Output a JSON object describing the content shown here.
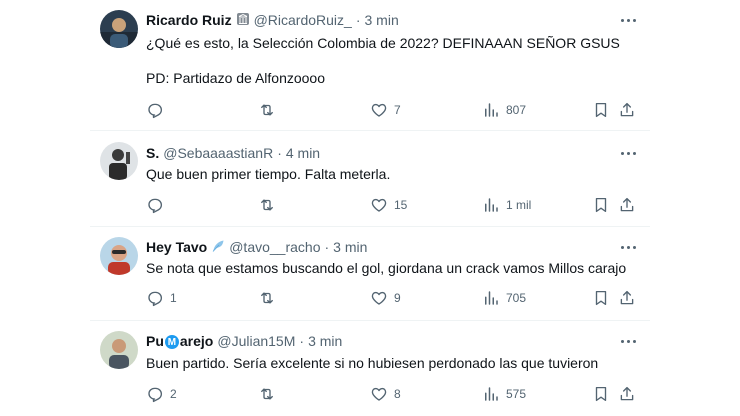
{
  "tweets": [
    {
      "name": "Ricardo Ruiz",
      "handle": "@RicardoRuiz_",
      "separator": "·",
      "time": "3 min",
      "text1": "¿Qué es esto, la Selección Colombia de 2022? DEFINAAAN SEÑOR GSUS",
      "text2": "PD: Partidazo de Alfonzoooo",
      "replies": "",
      "retweets": "",
      "likes": "7",
      "views": "807"
    },
    {
      "name": "S.",
      "handle": "@SebaaaastianR",
      "separator": "·",
      "time": "4 min",
      "text1": "Que buen primer tiempo. Falta meterla.",
      "replies": "",
      "retweets": "",
      "likes": "15",
      "views": "1 mil"
    },
    {
      "name": "Hey Tavo",
      "handle": "@tavo__racho",
      "separator": "·",
      "time": "3 min",
      "text1": "Se nota que estamos buscando el gol, giordana un crack vamos Millos carajo",
      "replies": "1",
      "retweets": "",
      "likes": "9",
      "views": "705"
    },
    {
      "name_a": "Pu",
      "name_m": "M",
      "name_b": "arejo",
      "handle": "@Julian15M",
      "separator": "·",
      "time": "3 min",
      "text1": "Buen partido. Sería excelente si no hubiesen perdonado las que tuvieron",
      "replies": "2",
      "retweets": "",
      "likes": "8",
      "views": "575"
    }
  ],
  "colors": {
    "text": "#0f1419",
    "muted": "#536471",
    "divider": "#eff3f4",
    "accent": "#1d9bf0"
  },
  "icons": [
    "reply-icon",
    "retweet-icon",
    "like-icon",
    "views-icon",
    "bookmark-icon",
    "share-icon",
    "more-icon",
    "building-badge-icon",
    "feather-badge-icon"
  ]
}
